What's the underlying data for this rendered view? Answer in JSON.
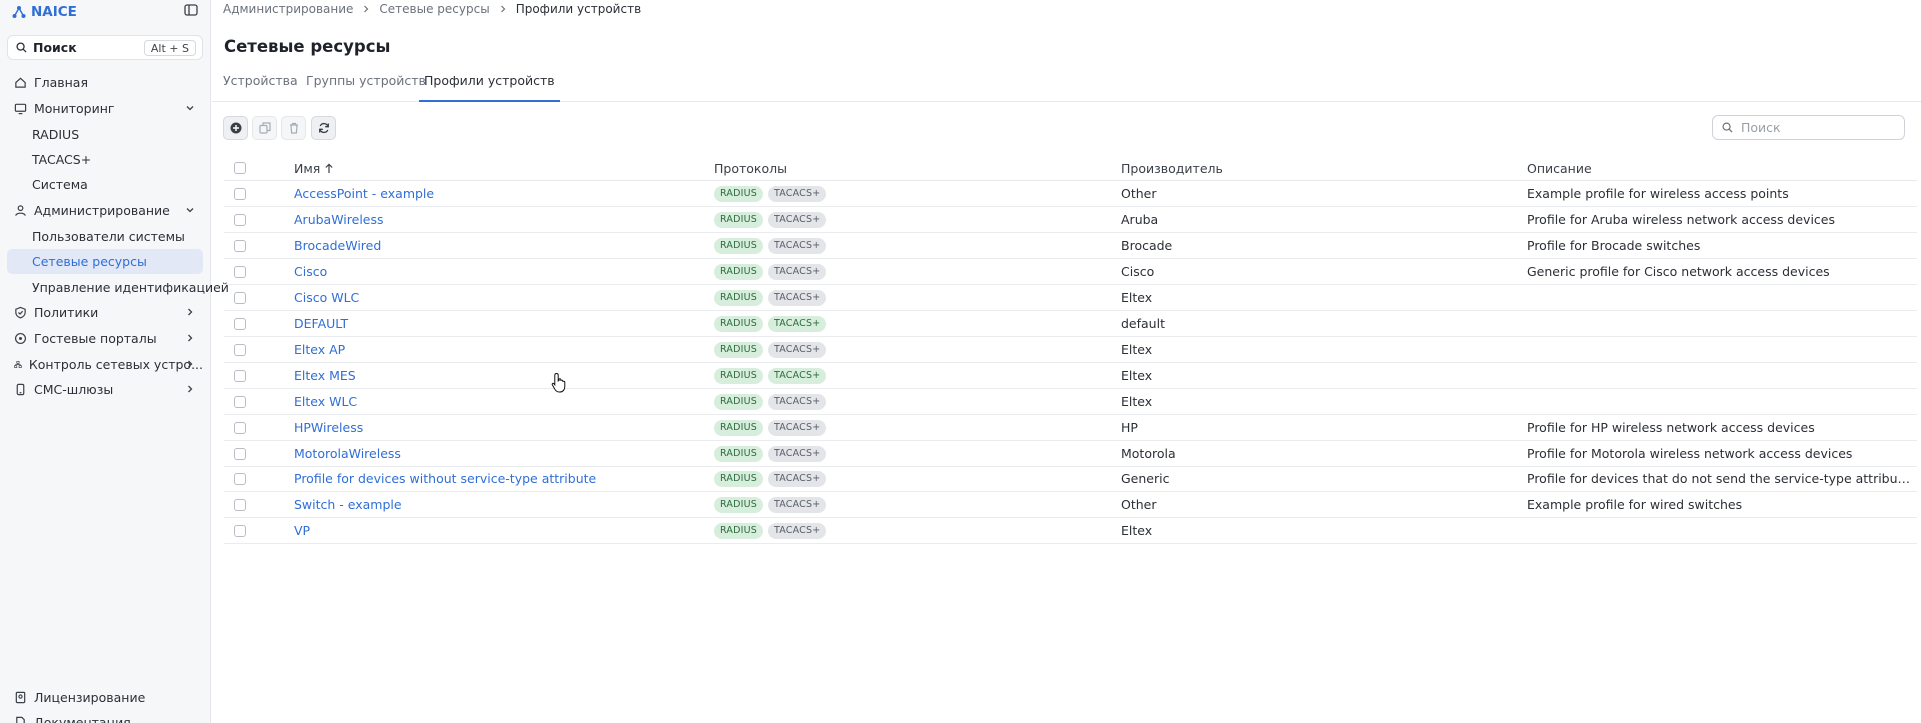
{
  "app": {
    "name": "NAICE"
  },
  "sidebar": {
    "search": {
      "label": "Поиск",
      "shortcut": "Alt + S"
    },
    "home": "Главная",
    "monitoring": {
      "label": "Мониторинг",
      "items": [
        "RADIUS",
        "TACACS+",
        "Система"
      ]
    },
    "admin": {
      "label": "Администрирование",
      "items": [
        "Пользователи системы",
        "Сетевые ресурсы",
        "Управление идентификацией"
      ]
    },
    "policies": "Политики",
    "guest": "Гостевые порталы",
    "control": "Контроль сетевых устро...",
    "sms": "СМС-шлюзы",
    "licensing": "Лицензирование",
    "docs": "Документация"
  },
  "breadcrumb": [
    "Администрирование",
    "Сетевые ресурсы",
    "Профили устройств"
  ],
  "page": {
    "title": "Сетевые ресурсы"
  },
  "tabs": [
    "Устройства",
    "Группы устройств",
    "Профили устройств"
  ],
  "table_search": {
    "placeholder": "Поиск"
  },
  "table": {
    "headers": {
      "name": "Имя",
      "protocols": "Протоколы",
      "maker": "Производитель",
      "desc": "Описание"
    },
    "badges": {
      "radius": "RADIUS",
      "tacacs": "TACACS+"
    },
    "rows": [
      {
        "name": "AccessPoint - example",
        "maker": "Other",
        "desc": "Example profile for wireless access points",
        "tacacs_on": false
      },
      {
        "name": "ArubaWireless",
        "maker": "Aruba",
        "desc": "Profile for Aruba wireless network access devices",
        "tacacs_on": false
      },
      {
        "name": "BrocadeWired",
        "maker": "Brocade",
        "desc": "Profile for Brocade switches",
        "tacacs_on": false
      },
      {
        "name": "Cisco",
        "maker": "Cisco",
        "desc": "Generic profile for Cisco network access devices",
        "tacacs_on": false
      },
      {
        "name": "Cisco WLC",
        "maker": "Eltex",
        "desc": "",
        "tacacs_on": false
      },
      {
        "name": "DEFAULT",
        "maker": "default",
        "desc": "",
        "tacacs_on": true
      },
      {
        "name": "Eltex AP",
        "maker": "Eltex",
        "desc": "",
        "tacacs_on": false
      },
      {
        "name": "Eltex MES",
        "maker": "Eltex",
        "desc": "",
        "tacacs_on": true
      },
      {
        "name": "Eltex WLC",
        "maker": "Eltex",
        "desc": "",
        "tacacs_on": false
      },
      {
        "name": "HPWireless",
        "maker": "HP",
        "desc": "Profile for HP wireless network access devices",
        "tacacs_on": false
      },
      {
        "name": "MotorolaWireless",
        "maker": "Motorola",
        "desc": "Profile for Motorola wireless network access devices",
        "tacacs_on": false
      },
      {
        "name": "Profile for devices without service-type attribute",
        "maker": "Generic",
        "desc": "Profile for devices that do not send the service-type attribute in RADIUS ...",
        "tacacs_on": false
      },
      {
        "name": "Switch - example",
        "maker": "Other",
        "desc": "Example profile for wired switches",
        "tacacs_on": false
      },
      {
        "name": "VP",
        "maker": "Eltex",
        "desc": "",
        "tacacs_on": false
      }
    ]
  },
  "colors": {
    "accent": "#2f6fd6",
    "active_bg": "#e2e8f5",
    "badge_green": "#d8eedd",
    "badge_gray": "#e3e5e9"
  }
}
